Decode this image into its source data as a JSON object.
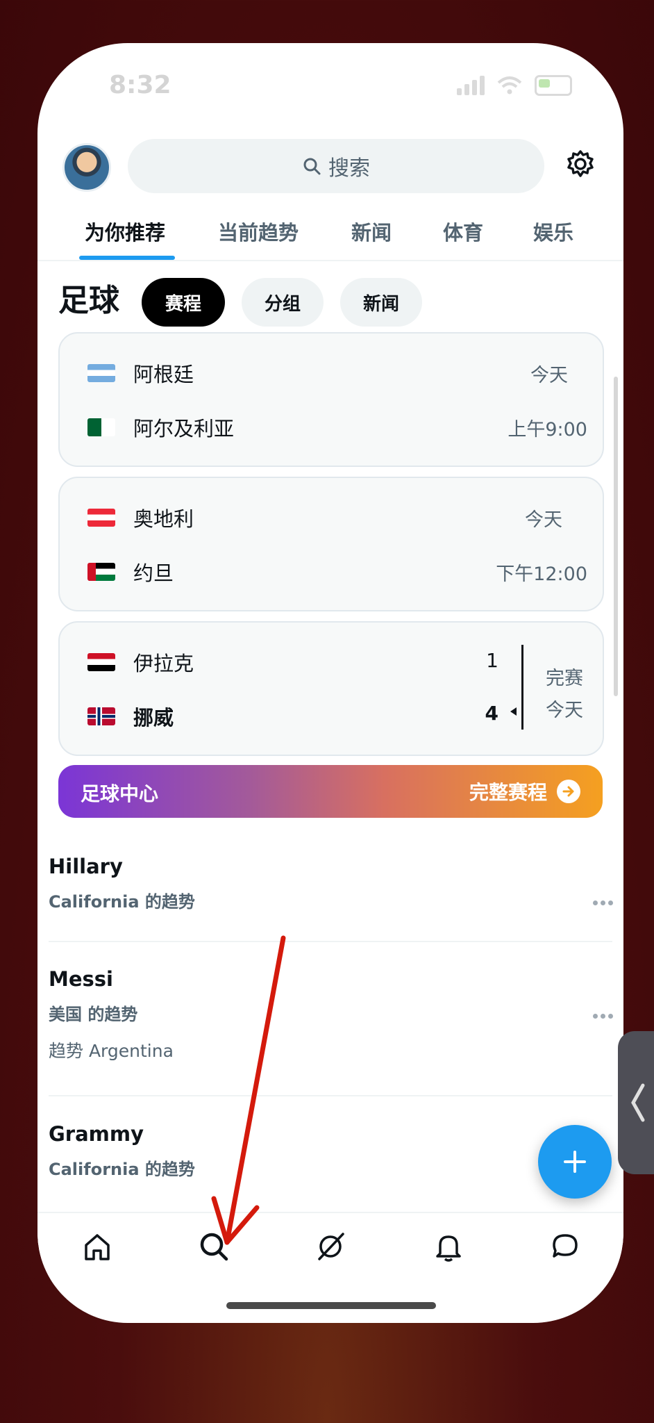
{
  "status": {
    "time": "8:32"
  },
  "search": {
    "placeholder": "搜索"
  },
  "tabs": [
    {
      "label": "为你推荐"
    },
    {
      "label": "当前趋势"
    },
    {
      "label": "新闻"
    },
    {
      "label": "体育"
    },
    {
      "label": "娱乐"
    }
  ],
  "soccer": {
    "title": "足球",
    "pills": [
      {
        "label": "赛程"
      },
      {
        "label": "分组"
      },
      {
        "label": "新闻"
      }
    ],
    "matches": [
      {
        "team1": "阿根廷",
        "team2": "阿尔及利亚",
        "day": "今天",
        "time": "上午9:00"
      },
      {
        "team1": "奥地利",
        "team2": "约旦",
        "day": "今天",
        "time": "下午12:00"
      },
      {
        "team1": "伊拉克",
        "team2": "挪威",
        "score1": "1",
        "score2": "4",
        "status": "完赛",
        "day": "今天"
      }
    ],
    "banner_left": "足球中心",
    "banner_right": "完整赛程"
  },
  "trends": [
    {
      "name": "Hillary",
      "sub": "California 的趋势"
    },
    {
      "name": "Messi",
      "sub": "美国 的趋势",
      "extra": "趋势 Argentina"
    },
    {
      "name": "Grammy",
      "sub": "California 的趋势"
    }
  ],
  "icons": {
    "nav": [
      "home-icon",
      "search-icon",
      "grok-icon",
      "bell-icon",
      "message-icon"
    ],
    "fab": "plus-icon"
  },
  "colors": {
    "accent": "#1d9bf0",
    "banner_start": "#7b35d6",
    "banner_end": "#f5a020",
    "annotation_arrow": "#d41a0c"
  }
}
